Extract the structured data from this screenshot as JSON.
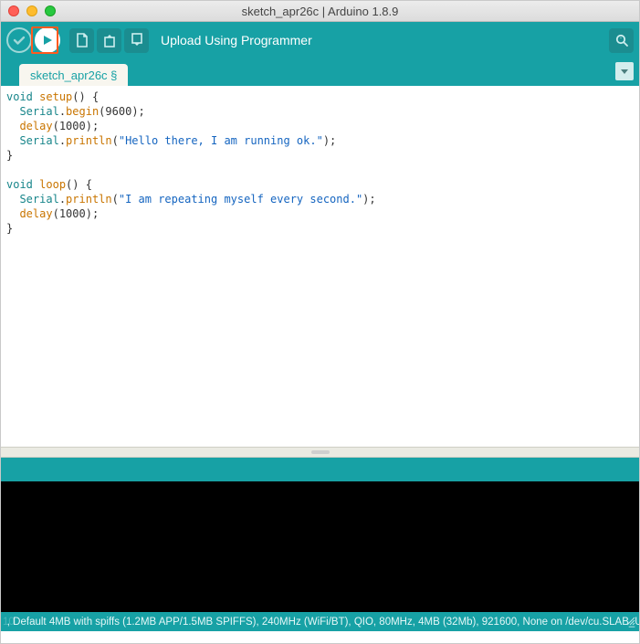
{
  "window": {
    "title": "sketch_apr26c | Arduino 1.8.9"
  },
  "toolbar": {
    "status_text": "Upload Using Programmer",
    "buttons": {
      "verify": "verify",
      "upload": "upload",
      "new": "new",
      "open": "open",
      "save": "save",
      "serial_monitor": "serial-monitor"
    }
  },
  "tabs": {
    "active": "sketch_apr26c §"
  },
  "code": {
    "lines": [
      {
        "t": "void",
        "c": "kw"
      },
      {
        "t": " ",
        "c": ""
      },
      {
        "t": "setup",
        "c": "fn"
      },
      {
        "t": "() {",
        "c": ""
      },
      {
        "br": true
      },
      {
        "t": "  ",
        "c": ""
      },
      {
        "t": "Serial",
        "c": "kw"
      },
      {
        "t": ".",
        "c": ""
      },
      {
        "t": "begin",
        "c": "fn"
      },
      {
        "t": "(",
        "c": ""
      },
      {
        "t": "9600",
        "c": "num"
      },
      {
        "t": ");",
        "c": ""
      },
      {
        "br": true
      },
      {
        "t": "  ",
        "c": ""
      },
      {
        "t": "delay",
        "c": "fn"
      },
      {
        "t": "(",
        "c": ""
      },
      {
        "t": "1000",
        "c": "num"
      },
      {
        "t": ");",
        "c": ""
      },
      {
        "br": true
      },
      {
        "t": "  ",
        "c": ""
      },
      {
        "t": "Serial",
        "c": "kw"
      },
      {
        "t": ".",
        "c": ""
      },
      {
        "t": "println",
        "c": "fn"
      },
      {
        "t": "(",
        "c": ""
      },
      {
        "t": "\"Hello there, I am running ok.\"",
        "c": "str"
      },
      {
        "t": ");",
        "c": ""
      },
      {
        "br": true
      },
      {
        "t": "}",
        "c": ""
      },
      {
        "br": true
      },
      {
        "br": true
      },
      {
        "t": "void",
        "c": "kw"
      },
      {
        "t": " ",
        "c": ""
      },
      {
        "t": "loop",
        "c": "fn"
      },
      {
        "t": "() {",
        "c": ""
      },
      {
        "br": true
      },
      {
        "t": "  ",
        "c": ""
      },
      {
        "t": "Serial",
        "c": "kw"
      },
      {
        "t": ".",
        "c": ""
      },
      {
        "t": "println",
        "c": "fn"
      },
      {
        "t": "(",
        "c": ""
      },
      {
        "t": "\"I am repeating myself every second.\"",
        "c": "str"
      },
      {
        "t": ");",
        "c": ""
      },
      {
        "br": true
      },
      {
        "t": "  ",
        "c": ""
      },
      {
        "t": "delay",
        "c": "fn"
      },
      {
        "t": "(",
        "c": ""
      },
      {
        "t": "1000",
        "c": "num"
      },
      {
        "t": ");",
        "c": ""
      },
      {
        "br": true
      },
      {
        "t": "}",
        "c": ""
      }
    ]
  },
  "statusbar": {
    "text": ", Default 4MB with spiffs (1.2MB APP/1.5MB SPIFFS), 240MHz (WiFi/BT), QIO, 80MHz, 4MB (32Mb), 921600, None on /dev/cu.SLAB_USBtoUART",
    "line_indicator": "10"
  }
}
